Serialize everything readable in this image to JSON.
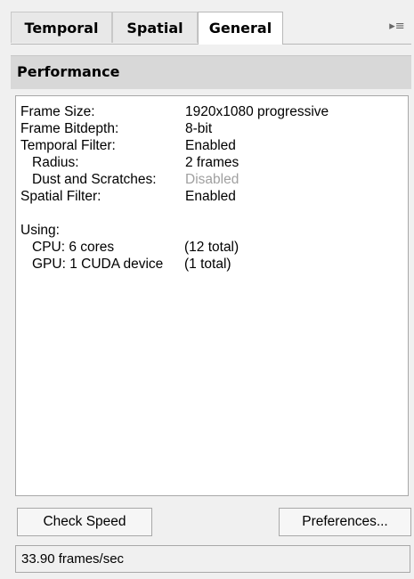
{
  "tabs": [
    {
      "label": "Temporal"
    },
    {
      "label": "Spatial"
    },
    {
      "label": "General"
    }
  ],
  "flyout_icon": "flyout-menu-icon",
  "flyout_glyph": "▸≡",
  "header": {
    "title": "Performance"
  },
  "info": {
    "frame_size_label": "Frame Size:",
    "frame_size_value": "1920x1080 progressive",
    "bitdepth_label": "Frame Bitdepth:",
    "bitdepth_value": "8-bit",
    "temporal_label": "Temporal Filter:",
    "temporal_value": "Enabled",
    "radius_label": "Radius:",
    "radius_value": "2 frames",
    "dust_label": "Dust and Scratches:",
    "dust_value": "Disabled",
    "spatial_label": "Spatial Filter:",
    "spatial_value": "Enabled",
    "using_label": "Using:",
    "cpu_label": "CPU: 6 cores",
    "cpu_value": "(12 total)",
    "gpu_label": "GPU: 1 CUDA device",
    "gpu_value": "(1 total)"
  },
  "buttons": {
    "check_speed": "Check Speed",
    "preferences": "Preferences..."
  },
  "status": {
    "text": "33.90 frames/sec"
  },
  "colors": {
    "disabled_text": "#a0a0a0",
    "header_bg": "#d8d8d8",
    "panel_bg": "#f0f0f0"
  }
}
